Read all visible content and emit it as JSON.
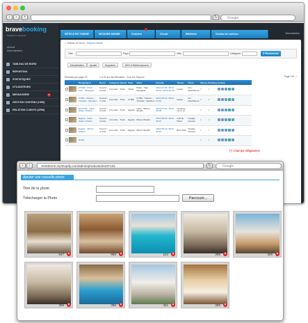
{
  "browser1": {
    "search_placeholder": "Google"
  },
  "brand": {
    "logo_a": "brave",
    "logo_b": "booking",
    "tagline": "Solutions e-tourisme"
  },
  "user": {
    "line1": "Allonnil",
    "line2": "Administrateur"
  },
  "sidebar": {
    "items": [
      {
        "label": "TABLEAU DE BORD"
      },
      {
        "label": "REPORTING"
      },
      {
        "label": "STATISTIQUES"
      },
      {
        "label": "UTILISATEURS"
      },
      {
        "label": "MESSAGERIE",
        "badge": "5"
      },
      {
        "label": "GESTION CONTENU (CMS)"
      },
      {
        "label": "RELATION CLIENTS (CRM)"
      }
    ]
  },
  "topnav": {
    "tabs": [
      {
        "label": "HÔTELS EN TUNISIE"
      },
      {
        "label": "SÉJOURS MONDE"
      },
      {
        "label": "Croisière"
      },
      {
        "label": "Circuit"
      },
      {
        "label": "Billetterie"
      },
      {
        "label": "Gestion de contenu"
      }
    ],
    "logout": "Déconnexion"
  },
  "breadcrumb": {
    "home": "Tableau de Bord",
    "current": "Séjours monde"
  },
  "filters": {
    "titre": "Titre",
    "pays": "Pays",
    "ville": "Ville",
    "categorie": "Catégorie",
    "search": "Rechercher"
  },
  "actions": {
    "desactiver": "Désactivation",
    "ajouter": "Ajouter",
    "supprimer": "Supprimer",
    "seo": "SEO & Référencement"
  },
  "table": {
    "info": "Résultat par page",
    "per_page": "20",
    "count": "1 à 20 sur 86 Résultats : Tous les Séjours",
    "page": "Page",
    "page_of": "1/5",
    "headers": [
      "",
      "",
      "Désignation",
      "Durée",
      "Catégorie",
      "Départ",
      "Pays",
      "Villes",
      "Période",
      "Thème",
      "Choix",
      "Vitesse",
      "Booking",
      "Actions"
    ],
    "rows": [
      {
        "name": "CHINE - Pékin - Xian - Shanghai",
        "duree": "5 jours / 4 nuits",
        "cat": "A la carte",
        "depart": "Tunis",
        "pays": "Chine",
        "ville": "Pékin - Xian - Shanghai",
        "periode": "2012-07-25 / 2012-09-13 / 2012-12-30",
        "theme": "Loisirs",
        "trans": "Vol / Aller/Retour"
      },
      {
        "name": "CUBA - Havane - Trinidad - Varadero",
        "duree": "8 jours / 7 nuits",
        "cat": "A la carte",
        "depart": "Tunis",
        "pays": "CUBA",
        "ville": "CUBA - Havane - Trinidad - Varadero",
        "periode": "2012-08-13 / 2012-12-10",
        "theme": "Sejour",
        "trans": "Vol Aller/Retour"
      },
      {
        "name": "EGYPTE - Caire - Sharm Sheikh",
        "duree": "5 jours / 4 nuits",
        "cat": "A la carte",
        "depart": "Tunis",
        "pays": "Egypte",
        "ville": "Caire - Sharm Sheikh",
        "periode": "2012-07-23 / 2012-08-05",
        "theme": "Croisière sur le nil",
        "trans": ""
      },
      {
        "name": "Egypte - Caire Sharm Sheikh",
        "duree": "5 jours / 4 nuits",
        "cat": "A la carte",
        "depart": "Tunis",
        "pays": "Egypte",
        "ville": "Sharm Sheikh",
        "periode": "2012-08-25 / 2012-09-07",
        "theme": "Golf de Hilton",
        "trans": "Voyage Couvert"
      },
      {
        "name": "Egypte - Sharm Sheikh",
        "duree": "5 jours / 4 nuits",
        "cat": "A la carte",
        "depart": "Tunis",
        "pays": "Egypte",
        "ville": "Sharm Sheikh",
        "periode": "2012-08-13 / 2012-09-13",
        "theme": "Bolo Deal",
        "trans": "Voyage Couvert"
      },
      {
        "name": "Dubai",
        "duree": "",
        "cat": "",
        "depart": "",
        "pays": "",
        "ville": "",
        "periode": "",
        "theme": "",
        "trans": ""
      }
    ]
  },
  "browser2": {
    "url": "zenitheme.myshopify.com/admin/products/21197102"
  },
  "form": {
    "header": "Ajouter une nouvelle photo",
    "titre_label": "Titre de la photo",
    "upload_label": "Télécharger la Photo",
    "browse": "Parcourir...",
    "required": "(*) Champs obligatoires"
  },
  "photos": [
    {
      "id": "547",
      "theme": "conference room"
    },
    {
      "id": "983",
      "theme": "banquet hall"
    },
    {
      "id": "223",
      "theme": "pool"
    },
    {
      "id": "305",
      "theme": "hotel room"
    },
    {
      "id": "306",
      "theme": "beach terrace"
    },
    {
      "id": "399",
      "theme": "hotel room"
    },
    {
      "id": "396",
      "theme": "indoor pool"
    },
    {
      "id": "461",
      "theme": "resort"
    },
    {
      "id": "305",
      "theme": "restaurant"
    }
  ]
}
